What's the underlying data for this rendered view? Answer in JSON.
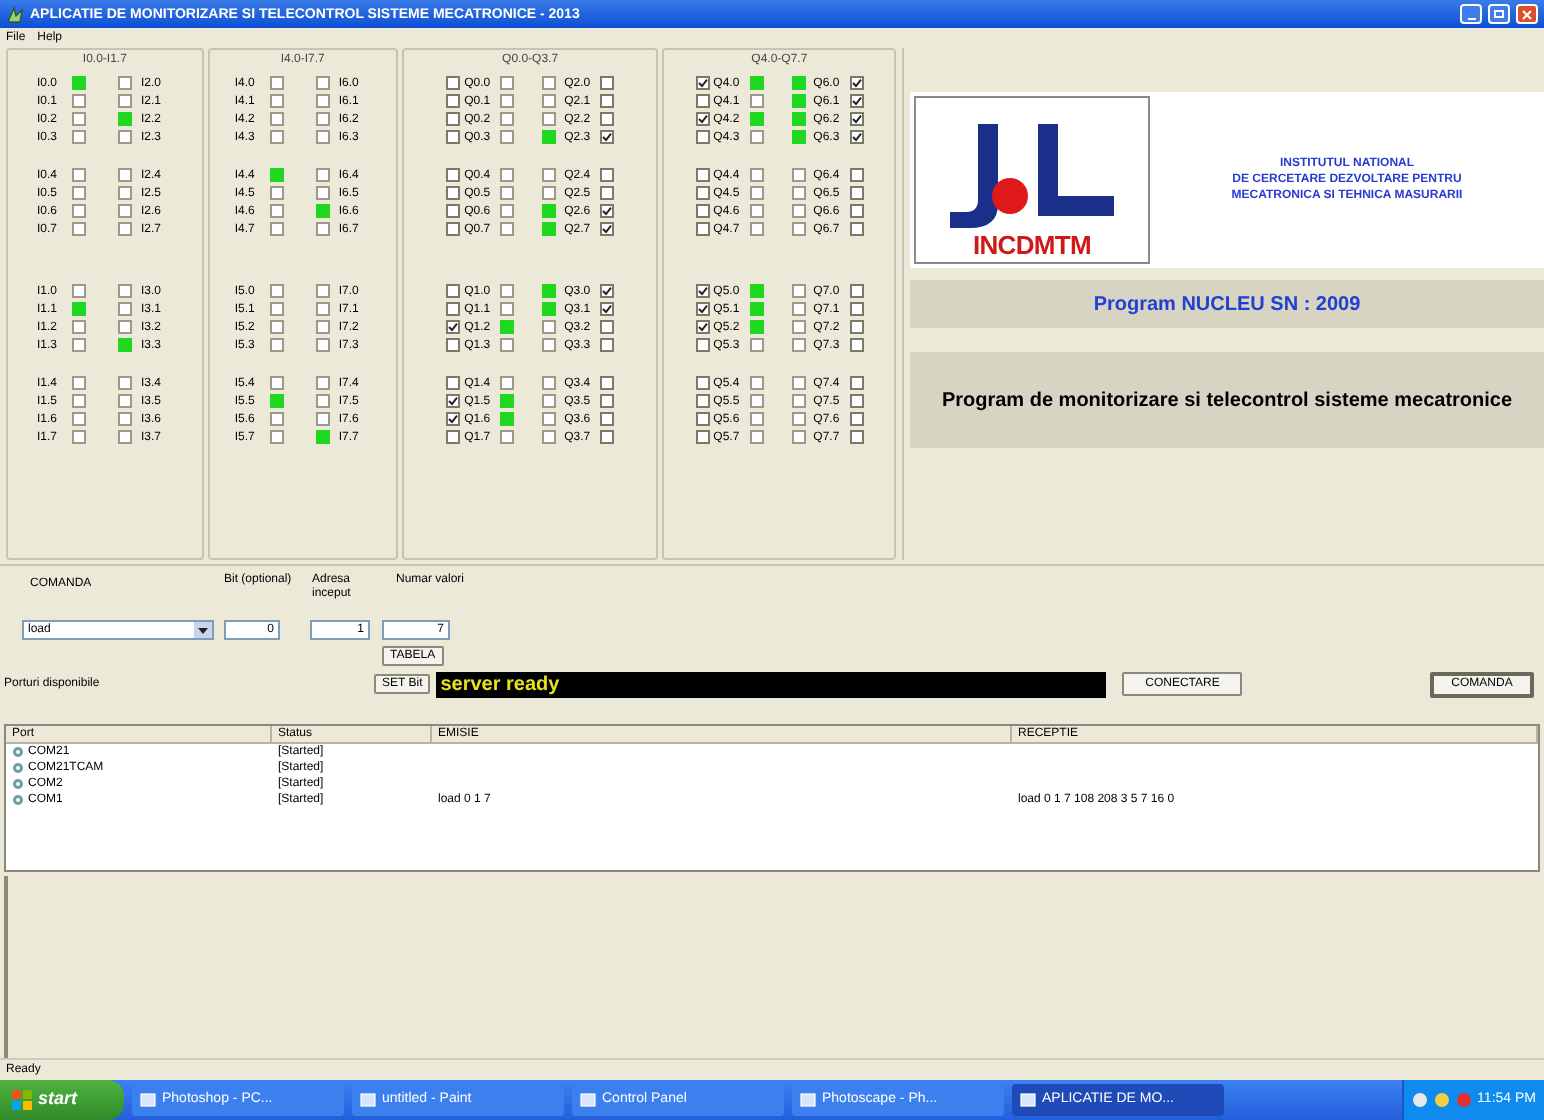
{
  "window": {
    "title": "APLICATIE DE MONITORIZARE SI TELECONTROL SISTEME MECATRONICE - 2013"
  },
  "menu": [
    "File",
    "Help"
  ],
  "groups": [
    {
      "title": "I0.0-I1.7",
      "kind": "inputs",
      "blocks": [
        [
          {
            "a": "I0.0",
            "b": "I2.0",
            "led_a": true,
            "led_b": false
          },
          {
            "a": "I0.1",
            "b": "I2.1",
            "led_a": false,
            "led_b": false
          },
          {
            "a": "I0.2",
            "b": "I2.2",
            "led_a": false,
            "led_b": true
          },
          {
            "a": "I0.3",
            "b": "I2.3",
            "led_a": false,
            "led_b": false
          },
          {
            "a": "I0.4",
            "b": "I2.4",
            "led_a": false,
            "led_b": false
          },
          {
            "a": "I0.5",
            "b": "I2.5",
            "led_a": false,
            "led_b": false
          },
          {
            "a": "I0.6",
            "b": "I2.6",
            "led_a": false,
            "led_b": false
          },
          {
            "a": "I0.7",
            "b": "I2.7",
            "led_a": false,
            "led_b": false
          }
        ],
        [
          {
            "a": "I1.0",
            "b": "I3.0",
            "led_a": false,
            "led_b": false
          },
          {
            "a": "I1.1",
            "b": "I3.1",
            "led_a": true,
            "led_b": false
          },
          {
            "a": "I1.2",
            "b": "I3.2",
            "led_a": false,
            "led_b": false
          },
          {
            "a": "I1.3",
            "b": "I3.3",
            "led_a": false,
            "led_b": true
          },
          {
            "a": "I1.4",
            "b": "I3.4",
            "led_a": false,
            "led_b": false
          },
          {
            "a": "I1.5",
            "b": "I3.5",
            "led_a": false,
            "led_b": false
          },
          {
            "a": "I1.6",
            "b": "I3.6",
            "led_a": false,
            "led_b": false
          },
          {
            "a": "I1.7",
            "b": "I3.7",
            "led_a": false,
            "led_b": false
          }
        ]
      ]
    },
    {
      "title": "I4.0-I7.7",
      "kind": "inputs",
      "blocks": [
        [
          {
            "a": "I4.0",
            "b": "I6.0",
            "led_a": false,
            "led_b": false
          },
          {
            "a": "I4.1",
            "b": "I6.1",
            "led_a": false,
            "led_b": false
          },
          {
            "a": "I4.2",
            "b": "I6.2",
            "led_a": false,
            "led_b": false
          },
          {
            "a": "I4.3",
            "b": "I6.3",
            "led_a": false,
            "led_b": false
          },
          {
            "a": "I4.4",
            "b": "I6.4",
            "led_a": true,
            "led_b": false
          },
          {
            "a": "I4.5",
            "b": "I6.5",
            "led_a": false,
            "led_b": false
          },
          {
            "a": "I4.6",
            "b": "I6.6",
            "led_a": false,
            "led_b": true
          },
          {
            "a": "I4.7",
            "b": "I6.7",
            "led_a": false,
            "led_b": false
          }
        ],
        [
          {
            "a": "I5.0",
            "b": "I7.0",
            "led_a": false,
            "led_b": false
          },
          {
            "a": "I5.1",
            "b": "I7.1",
            "led_a": false,
            "led_b": false
          },
          {
            "a": "I5.2",
            "b": "I7.2",
            "led_a": false,
            "led_b": false
          },
          {
            "a": "I5.3",
            "b": "I7.3",
            "led_a": false,
            "led_b": false
          },
          {
            "a": "I5.4",
            "b": "I7.4",
            "led_a": false,
            "led_b": false
          },
          {
            "a": "I5.5",
            "b": "I7.5",
            "led_a": true,
            "led_b": false
          },
          {
            "a": "I5.6",
            "b": "I7.6",
            "led_a": false,
            "led_b": false
          },
          {
            "a": "I5.7",
            "b": "I7.7",
            "led_a": false,
            "led_b": true
          }
        ]
      ]
    },
    {
      "title": "Q0.0-Q3.7",
      "kind": "outputs",
      "blocks": [
        [
          {
            "a": "Q0.0",
            "b": "Q2.0",
            "led_a": false,
            "led_b": false,
            "check_a": false,
            "check_b": false
          },
          {
            "a": "Q0.1",
            "b": "Q2.1",
            "led_a": false,
            "led_b": false,
            "check_a": false,
            "check_b": false
          },
          {
            "a": "Q0.2",
            "b": "Q2.2",
            "led_a": false,
            "led_b": false,
            "check_a": false,
            "check_b": false
          },
          {
            "a": "Q0.3",
            "b": "Q2.3",
            "led_a": false,
            "led_b": true,
            "check_a": false,
            "check_b": true
          },
          {
            "a": "Q0.4",
            "b": "Q2.4",
            "led_a": false,
            "led_b": false,
            "check_a": false,
            "check_b": false
          },
          {
            "a": "Q0.5",
            "b": "Q2.5",
            "led_a": false,
            "led_b": false,
            "check_a": false,
            "check_b": false
          },
          {
            "a": "Q0.6",
            "b": "Q2.6",
            "led_a": false,
            "led_b": true,
            "check_a": false,
            "check_b": true
          },
          {
            "a": "Q0.7",
            "b": "Q2.7",
            "led_a": false,
            "led_b": true,
            "check_a": false,
            "check_b": true
          }
        ],
        [
          {
            "a": "Q1.0",
            "b": "Q3.0",
            "led_a": false,
            "led_b": true,
            "check_a": false,
            "check_b": true
          },
          {
            "a": "Q1.1",
            "b": "Q3.1",
            "led_a": false,
            "led_b": true,
            "check_a": false,
            "check_b": true
          },
          {
            "a": "Q1.2",
            "b": "Q3.2",
            "led_a": true,
            "led_b": false,
            "check_a": true,
            "check_b": false
          },
          {
            "a": "Q1.3",
            "b": "Q3.3",
            "led_a": false,
            "led_b": false,
            "check_a": false,
            "check_b": false
          },
          {
            "a": "Q1.4",
            "b": "Q3.4",
            "led_a": false,
            "led_b": false,
            "check_a": false,
            "check_b": false
          },
          {
            "a": "Q1.5",
            "b": "Q3.5",
            "led_a": true,
            "led_b": false,
            "check_a": true,
            "check_b": false
          },
          {
            "a": "Q1.6",
            "b": "Q3.6",
            "led_a": true,
            "led_b": false,
            "check_a": true,
            "check_b": false
          },
          {
            "a": "Q1.7",
            "b": "Q3.7",
            "led_a": false,
            "led_b": false,
            "check_a": false,
            "check_b": false
          }
        ]
      ]
    },
    {
      "title": "Q4.0-Q7.7",
      "kind": "outputs",
      "blocks": [
        [
          {
            "a": "Q4.0",
            "b": "Q6.0",
            "led_a": true,
            "led_b": true,
            "check_a": true,
            "check_b": true
          },
          {
            "a": "Q4.1",
            "b": "Q6.1",
            "led_a": false,
            "led_b": true,
            "check_a": false,
            "check_b": true
          },
          {
            "a": "Q4.2",
            "b": "Q6.2",
            "led_a": true,
            "led_b": true,
            "check_a": true,
            "check_b": true
          },
          {
            "a": "Q4.3",
            "b": "Q6.3",
            "led_a": false,
            "led_b": true,
            "check_a": false,
            "check_b": true
          },
          {
            "a": "Q4.4",
            "b": "Q6.4",
            "led_a": false,
            "led_b": false,
            "check_a": false,
            "check_b": false
          },
          {
            "a": "Q4.5",
            "b": "Q6.5",
            "led_a": false,
            "led_b": false,
            "check_a": false,
            "check_b": false
          },
          {
            "a": "Q4.6",
            "b": "Q6.6",
            "led_a": false,
            "led_b": false,
            "check_a": false,
            "check_b": false
          },
          {
            "a": "Q4.7",
            "b": "Q6.7",
            "led_a": false,
            "led_b": false,
            "check_a": false,
            "check_b": false
          }
        ],
        [
          {
            "a": "Q5.0",
            "b": "Q7.0",
            "led_a": true,
            "led_b": false,
            "check_a": true,
            "check_b": false
          },
          {
            "a": "Q5.1",
            "b": "Q7.1",
            "led_a": true,
            "led_b": false,
            "check_a": true,
            "check_b": false
          },
          {
            "a": "Q5.2",
            "b": "Q7.2",
            "led_a": true,
            "led_b": false,
            "check_a": true,
            "check_b": false
          },
          {
            "a": "Q5.3",
            "b": "Q7.3",
            "led_a": false,
            "led_b": false,
            "check_a": false,
            "check_b": false
          },
          {
            "a": "Q5.4",
            "b": "Q7.4",
            "led_a": false,
            "led_b": false,
            "check_a": false,
            "check_b": false
          },
          {
            "a": "Q5.5",
            "b": "Q7.5",
            "led_a": false,
            "led_b": false,
            "check_a": false,
            "check_b": false
          },
          {
            "a": "Q5.6",
            "b": "Q7.6",
            "led_a": false,
            "led_b": false,
            "check_a": false,
            "check_b": false
          },
          {
            "a": "Q5.7",
            "b": "Q7.7",
            "led_a": false,
            "led_b": false,
            "check_a": false,
            "check_b": false
          }
        ]
      ]
    }
  ],
  "info": {
    "logo_text": "INCDMTM",
    "institute": [
      "INSTITUTUL NATIONAL",
      "DE CERCETARE DEZVOLTARE PENTRU",
      "MECATRONICA SI TEHNICA MASURARII"
    ],
    "program": "Program NUCLEU SN : 2009",
    "description": "Program de monitorizare si telecontrol sisteme mecatronice"
  },
  "command": {
    "label": "COMANDA",
    "value": "load"
  },
  "fields": [
    {
      "label": "Bit (optional)",
      "value": "0"
    },
    {
      "label": "Adresa inceput",
      "value": "1"
    },
    {
      "label": "Numar valori",
      "value": "7"
    }
  ],
  "table_button": "TABELA",
  "ports_label": "Porturi disponibile",
  "set_bit_button": "SET Bit",
  "server_status": "server ready",
  "connect_button": "CONECTARE",
  "send_button": "COMANDA",
  "table": {
    "columns": [
      "Port",
      "Status",
      "EMISIE",
      "RECEPTIE"
    ],
    "rows": [
      [
        "COM21",
        "[Started]",
        "",
        ""
      ],
      [
        "COM21TCAM",
        "[Started]",
        "",
        ""
      ],
      [
        "COM2",
        "[Started]",
        "",
        ""
      ],
      [
        "COM1",
        "[Started]",
        "load 0 1 7",
        "load 0 1 7 108 208 3 5 7 16 0"
      ]
    ]
  },
  "status_bar": "Ready",
  "taskbar": {
    "start": "start",
    "items": [
      {
        "label": "Photoshop - PC...",
        "selected": false
      },
      {
        "label": "untitled - Paint",
        "selected": false
      },
      {
        "label": "Control Panel",
        "selected": false
      },
      {
        "label": "Photoscape - Ph...",
        "selected": false
      },
      {
        "label": "APLICATIE DE MO...",
        "selected": true
      }
    ],
    "clock": "11:54 PM"
  }
}
